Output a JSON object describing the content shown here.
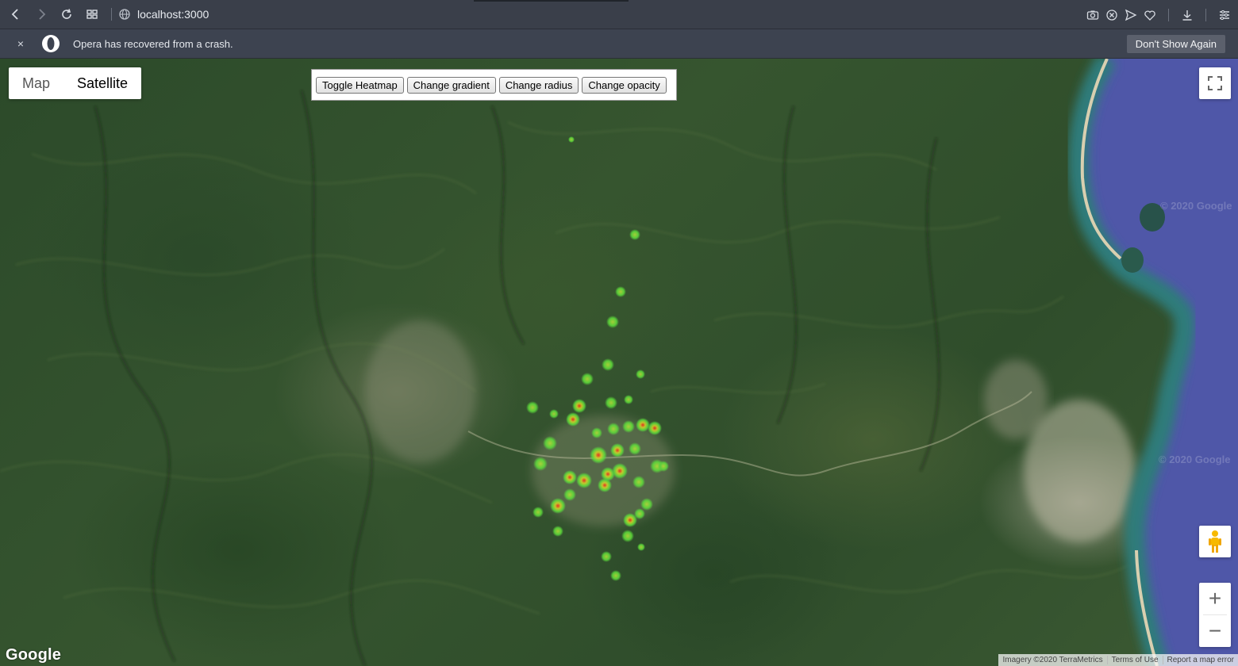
{
  "browser": {
    "url": "localhost:3000",
    "icons": [
      "back-icon",
      "forward-icon",
      "reload-icon",
      "tabs-grid-icon",
      "globe-icon",
      "camera-icon",
      "adblock-icon",
      "send-icon",
      "heart-icon",
      "download-icon",
      "menu-icon"
    ]
  },
  "notification": {
    "close_label": "×",
    "message": "Opera has recovered from a crash.",
    "button_label": "Don't Show Again"
  },
  "map": {
    "type_options": [
      "Map",
      "Satellite"
    ],
    "selected_type": "Satellite",
    "controls": [
      "Toggle Heatmap",
      "Change gradient",
      "Change radius",
      "Change opacity"
    ],
    "zoom_in_label": "+",
    "zoom_out_label": "−",
    "logo": "Google",
    "watermarks": [
      "© 2020 Google",
      "© 2020 Google"
    ],
    "attribution": [
      "Imagery ©2020 TerraMetrics",
      "Terms of Use",
      "Report a map error"
    ],
    "heatmap_points": 58
  }
}
